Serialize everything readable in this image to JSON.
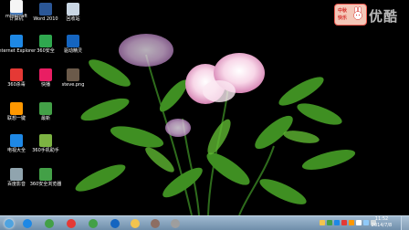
{
  "desktop": {
    "icons": [
      {
        "label": "计算机",
        "icon": "computer-icon",
        "color": "#4a7fc1"
      },
      {
        "label": "Word 2010",
        "icon": "word-icon",
        "color": "#2b5797"
      },
      {
        "label": "回收站",
        "icon": "recycle-bin-icon",
        "color": "#c9d6e3"
      },
      {
        "label": "Internet Explorer",
        "icon": "ie-icon",
        "color": "#1e88e5"
      },
      {
        "label": "360安全",
        "icon": "360-security-icon",
        "color": "#2fa84f"
      },
      {
        "label": "驱动精灵",
        "icon": "driver-genius-icon",
        "color": "#1565c0"
      },
      {
        "label": "360杀毒",
        "icon": "360-antivirus-icon",
        "color": "#e53935"
      },
      {
        "label": "快播",
        "icon": "qvod-icon",
        "color": "#e91e63"
      },
      {
        "label": "steve.png",
        "icon": "image-file-icon",
        "color": "#6b5a4a"
      },
      {
        "label": "联想一键",
        "icon": "lenovo-icon",
        "color": "#ff9800"
      },
      {
        "label": "最新",
        "icon": "recovery-icon",
        "color": "#43a047"
      },
      {
        "label": "电视大全",
        "icon": "tv-icon",
        "color": "#1e88e5"
      },
      {
        "label": "360手机助手",
        "icon": "phone-assistant-icon",
        "color": "#7cb342"
      },
      {
        "label": "百度影音",
        "icon": "baidu-video-icon",
        "color": "#90a4ae"
      },
      {
        "label": "360安全浏览器",
        "icon": "360-browser-icon",
        "color": "#43a047"
      },
      {
        "label": "minecraft",
        "icon": "minecraft-icon",
        "color": "#f5f5f5"
      }
    ]
  },
  "watermark": {
    "badge_line1": "中秋",
    "badge_line2": "快乐",
    "text": "优酷"
  },
  "taskbar": {
    "buttons": [
      {
        "name": "start-button",
        "color": "#4fa3e0"
      },
      {
        "name": "taskbar-app-ie",
        "color": "#1e88e5"
      },
      {
        "name": "taskbar-app-360",
        "color": "#43a047"
      },
      {
        "name": "taskbar-app-media",
        "color": "#e53935"
      },
      {
        "name": "taskbar-app-360-browser",
        "color": "#43a047"
      },
      {
        "name": "taskbar-app-chat",
        "color": "#1565c0"
      },
      {
        "name": "taskbar-app-folder",
        "color": "#f2c44f"
      },
      {
        "name": "taskbar-app-steve",
        "color": "#8d6e63"
      },
      {
        "name": "taskbar-app-game",
        "color": "#9e9e9e"
      }
    ],
    "time": "11:52",
    "date": "2014/7/8"
  }
}
